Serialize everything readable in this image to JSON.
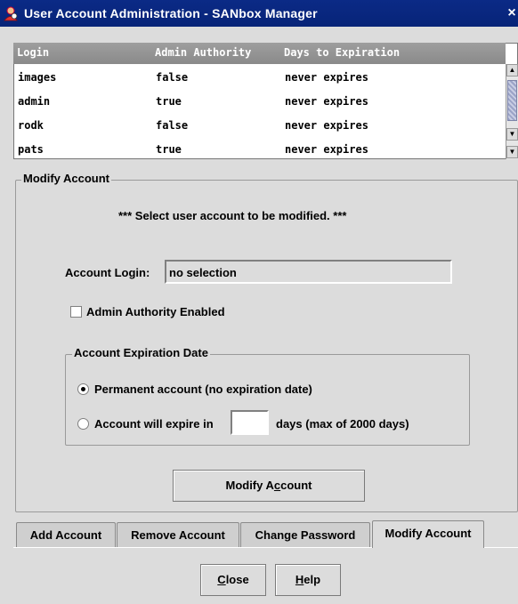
{
  "window": {
    "title": "User Account Administration - SANbox Manager",
    "close_glyph": "×",
    "icon": "app-icon"
  },
  "table": {
    "headers": [
      "Login",
      "Admin Authority",
      "Days to Expiration"
    ],
    "rows": [
      [
        "images",
        "false",
        "never expires"
      ],
      [
        "admin",
        "true",
        "never expires"
      ],
      [
        "rodk",
        "false",
        "never expires"
      ],
      [
        "pats",
        "true",
        "never expires"
      ]
    ]
  },
  "modify_account": {
    "legend": "Modify Account",
    "instruction": "*** Select user account to be modified. ***",
    "login_label": "Account Login:",
    "login_value": "no selection",
    "admin_authority_label": "Admin Authority Enabled",
    "admin_authority_checked": false,
    "expiration": {
      "legend": "Account Expiration Date",
      "permanent_label": "Permanent account (no expiration date)",
      "permanent_selected": true,
      "expire_prefix": "Account will expire in",
      "expire_days_value": "",
      "expire_suffix": "days (max of 2000 days)"
    },
    "modify_button": {
      "before": "Modify A",
      "mnemonic": "c",
      "after": "count"
    }
  },
  "tabs": [
    "Add Account",
    "Remove Account",
    "Change Password",
    "Modify Account"
  ],
  "active_tab": "Modify Account",
  "buttons": {
    "close": {
      "mnemonic": "C",
      "rest": "lose"
    },
    "help": {
      "mnemonic": "H",
      "rest": "elp"
    }
  },
  "colors": {
    "title_bar": "#0b2a86",
    "window_bg": "#dcdcdc",
    "header_bg": "#9e9e9e"
  }
}
